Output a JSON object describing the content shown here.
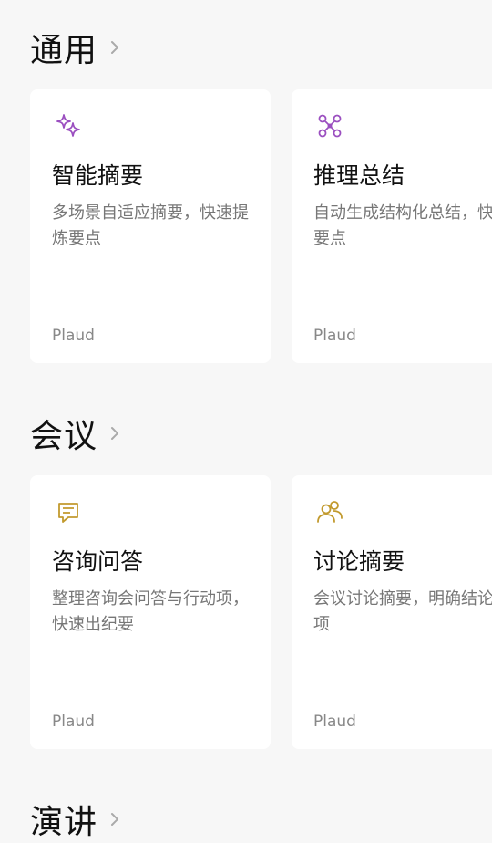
{
  "sections": [
    {
      "title": "通用",
      "cards": [
        {
          "icon": "sparkle-icon",
          "title": "智能摘要",
          "desc": "多场景自适应摘要，快速提炼要点",
          "source": "Plaud"
        },
        {
          "icon": "network-nodes-icon",
          "title": "推理总结",
          "desc": "自动生成结构化总结，快速把握要点",
          "source": "Plaud"
        }
      ]
    },
    {
      "title": "会议",
      "cards": [
        {
          "icon": "chat-document-icon",
          "title": "咨询问答",
          "desc": "整理咨询会问答与行动项，快速出纪要",
          "source": "Plaud"
        },
        {
          "icon": "people-icon",
          "title": "讨论摘要",
          "desc": "会议讨论摘要，明确结论与行动项",
          "source": "Plaud"
        }
      ]
    },
    {
      "title": "演讲",
      "cards": []
    }
  ],
  "colors": {
    "background": "#f7f7f7",
    "card": "#ffffff",
    "purple_icon": "#9b4fc0",
    "gold_icon": "#c29a2e"
  }
}
